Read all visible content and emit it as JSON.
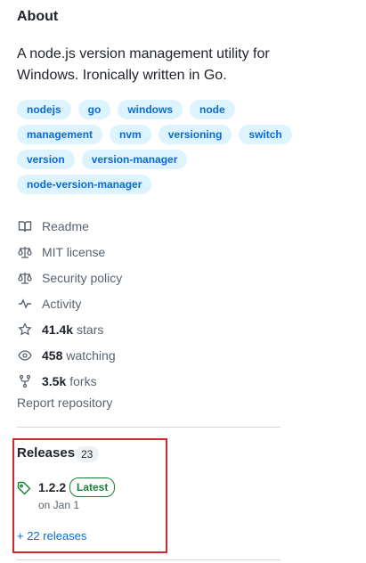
{
  "about": {
    "title": "About",
    "description": "A node.js version management utility for Windows. Ironically written in Go."
  },
  "topics": [
    [
      "nodejs",
      "go",
      "windows",
      "node"
    ],
    [
      "management",
      "nvm",
      "versioning",
      "switch"
    ],
    [
      "version",
      "version-manager"
    ],
    [
      "node-version-manager"
    ]
  ],
  "meta": {
    "readme": "Readme",
    "license": "MIT license",
    "security": "Security policy",
    "activity": "Activity",
    "stars_count": "41.4k",
    "stars_label": "stars",
    "watching_count": "458",
    "watching_label": "watching",
    "forks_count": "3.5k",
    "forks_label": "forks"
  },
  "report": "Report repository",
  "releases": {
    "title": "Releases",
    "count": "23",
    "latest_version": "1.2.2",
    "latest_badge": "Latest",
    "date": "on Jan 1",
    "more_link": "+ 22 releases"
  },
  "colors": {
    "topic_bg": "#ddf4ff",
    "topic_text": "#0969da",
    "latest_green": "#1a7f37",
    "highlight_red": "#d0282e"
  }
}
